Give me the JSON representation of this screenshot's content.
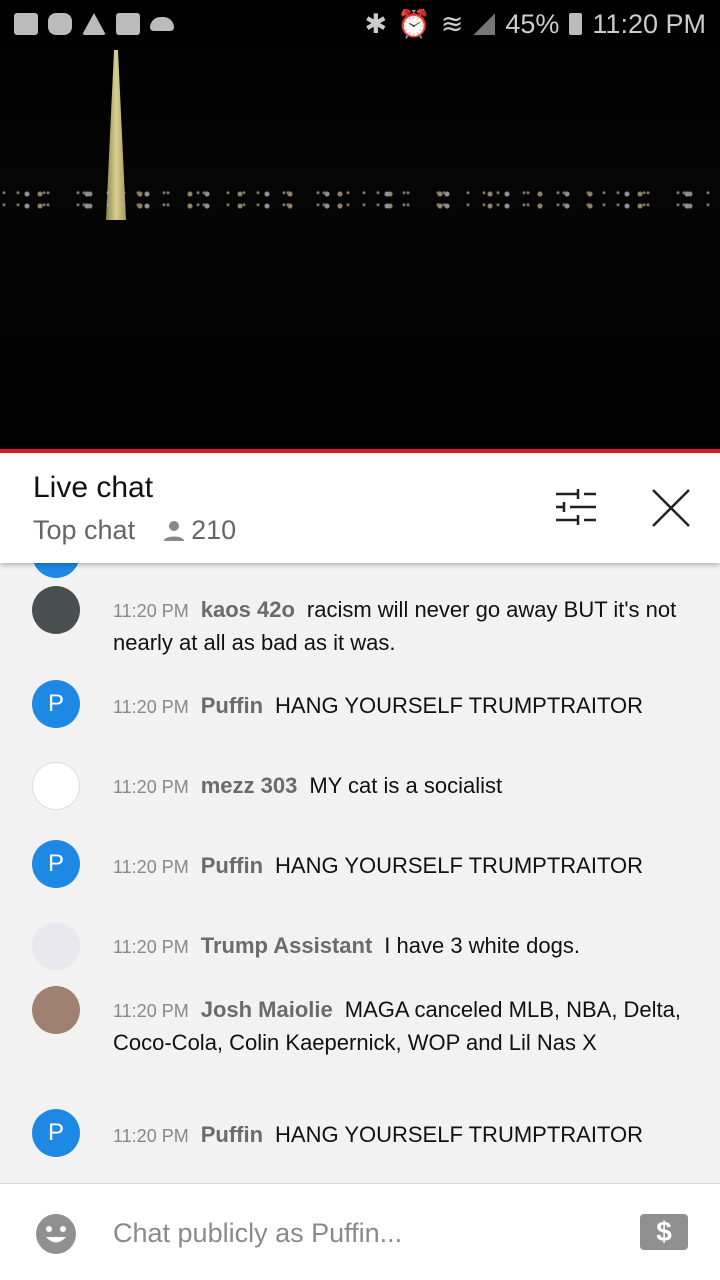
{
  "status_bar": {
    "battery": "45%",
    "time": "11:20 PM"
  },
  "header": {
    "title": "Live chat",
    "mode": "Top chat",
    "viewers": "210"
  },
  "colors": {
    "accent_red": "#e31b1b",
    "avatar_blue": "#1e88e5"
  },
  "messages": [
    {
      "time": "11:20 PM",
      "author": "kaos 42o",
      "text": "racism will never go away BUT it's not nearly at all as bad as it was.",
      "avatar": "car-photo"
    },
    {
      "time": "11:20 PM",
      "author": "Puffin",
      "text": "HANG YOURSELF TRUMPTRAITOR",
      "avatar": "P"
    },
    {
      "time": "11:20 PM",
      "author": "mezz 303",
      "text": "MY cat is a socialist",
      "avatar": "cartoon-face"
    },
    {
      "time": "11:20 PM",
      "author": "Puffin",
      "text": "HANG YOURSELF TRUMPTRAITOR",
      "avatar": "P"
    },
    {
      "time": "11:20 PM",
      "author": "Trump Assistant",
      "text": "I have 3 white dogs.",
      "avatar": "shirt-photo"
    },
    {
      "time": "11:20 PM",
      "author": "Josh Maiolie",
      "text": "MAGA canceled MLB, NBA, Delta, Coco-Cola, Colin Kaepernick, WOP and Lil Nas X",
      "avatar": "face-photo"
    },
    {
      "time": "11:20 PM",
      "author": "Puffin",
      "text": "HANG YOURSELF TRUMPTRAITOR",
      "avatar": "P"
    }
  ],
  "input": {
    "placeholder": "Chat publicly as Puffin..."
  }
}
